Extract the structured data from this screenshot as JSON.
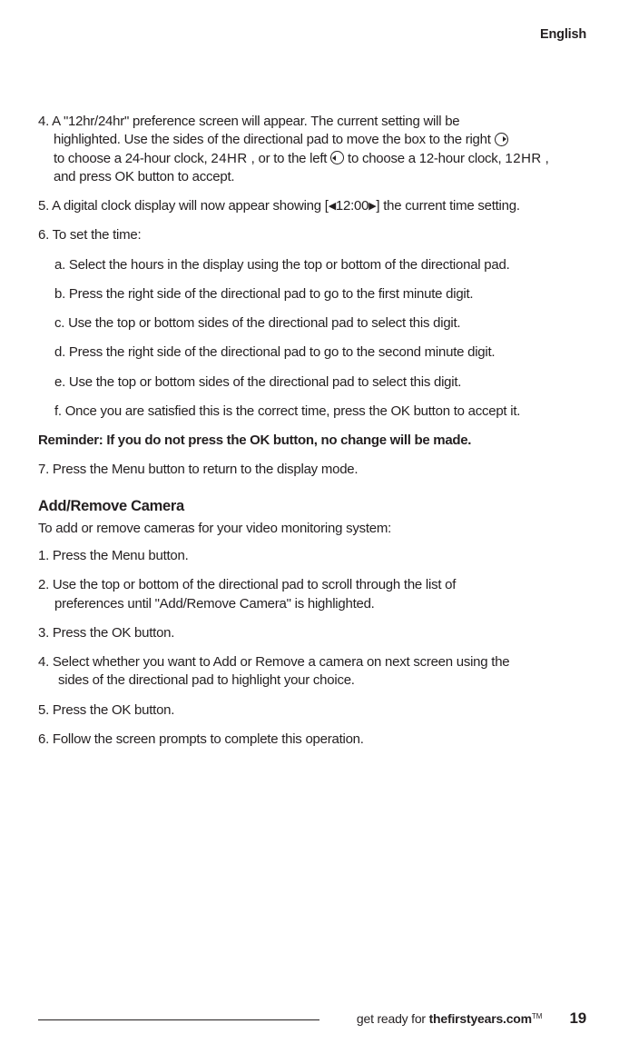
{
  "header": {
    "language": "English"
  },
  "steps": {
    "s4a": "4. A \"12hr/24hr\" preference screen will appear. The current setting will be",
    "s4b_pre": "highlighted. Use the sides of the directional pad to move the box to the right ",
    "s4c_pre": "to choose a 24-hour clock, ",
    "s4c_24hr": "24HR",
    "s4c_mid": " , or to the left ",
    "s4c_post": " to choose a 12-hour clock, ",
    "s4c_12hr": "12HR",
    "s4c_end": " ,",
    "s4d": "and press OK button to accept.",
    "s5_pre": "5. A digital clock display will now appear showing [",
    "s5_time": "12:00",
    "s5_post": "] the current time setting.",
    "s6": "6. To set the time:",
    "s6a": "a. Select the hours in the display using the top or bottom of the directional pad.",
    "s6b": "b. Press the right side of the directional pad to go to the first minute digit.",
    "s6c": "c. Use the top or bottom sides of the directional pad to select this digit.",
    "s6d": "d. Press the right side of the directional pad to go to the second minute digit.",
    "s6e": "e. Use the top or bottom sides of the directional pad to select this digit.",
    "s6f": "f.  Once you are satisfied this is the correct time, press the OK button to accept it.",
    "reminder": "Reminder: If you do not press the OK button, no change will be made.",
    "s7": "7. Press the Menu button to return to the display mode."
  },
  "section2": {
    "heading": "Add/Remove Camera",
    "intro": "To add or remove cameras for your video monitoring system:",
    "s1": "1.  Press the Menu button.",
    "s2a": "2. Use the top or bottom of the directional pad to scroll through the list of",
    "s2b": "preferences until \"Add/Remove Camera\" is highlighted.",
    "s3": "3. Press the OK button.",
    "s4a": "4.  Select whether you want to Add or Remove a camera on next screen using the",
    "s4b": "sides of the directional pad to highlight your choice.",
    "s5": "5.  Press the OK button.",
    "s6": "6.  Follow the screen prompts to complete this operation."
  },
  "footer": {
    "tagline_pre": "get ready for ",
    "tagline_bold": "thefirstyears.com",
    "tm": "TM",
    "page": "19"
  }
}
